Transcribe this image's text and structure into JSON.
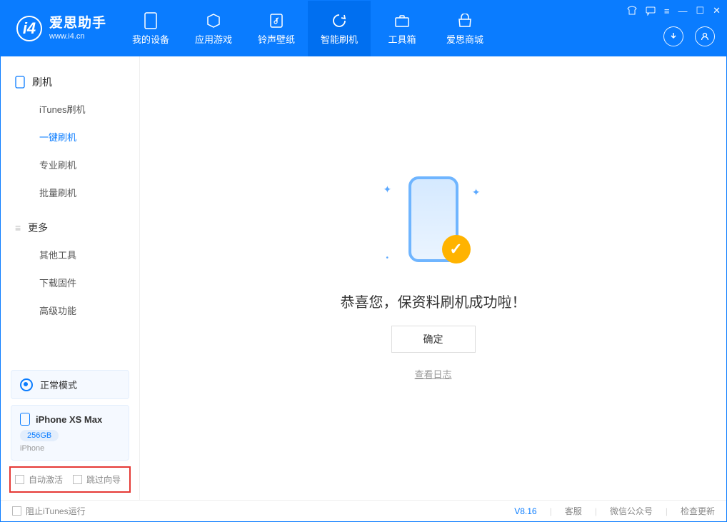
{
  "app": {
    "title": "爱思助手",
    "subtitle": "www.i4.cn"
  },
  "header_tabs": [
    {
      "label": "我的设备"
    },
    {
      "label": "应用游戏"
    },
    {
      "label": "铃声壁纸"
    },
    {
      "label": "智能刷机"
    },
    {
      "label": "工具箱"
    },
    {
      "label": "爱思商城"
    }
  ],
  "sidebar": {
    "section1_title": "刷机",
    "items1": [
      {
        "label": "iTunes刷机"
      },
      {
        "label": "一键刷机"
      },
      {
        "label": "专业刷机"
      },
      {
        "label": "批量刷机"
      }
    ],
    "section2_title": "更多",
    "items2": [
      {
        "label": "其他工具"
      },
      {
        "label": "下载固件"
      },
      {
        "label": "高级功能"
      }
    ],
    "mode": "正常模式",
    "device": {
      "name": "iPhone XS Max",
      "capacity": "256GB",
      "type": "iPhone"
    },
    "cb1": "自动激活",
    "cb2": "跳过向导"
  },
  "main": {
    "success_text": "恭喜您，保资料刷机成功啦！",
    "ok_button": "确定",
    "view_log": "查看日志"
  },
  "status": {
    "block_itunes": "阻止iTunes运行",
    "version": "V8.16",
    "support": "客服",
    "wechat": "微信公众号",
    "update": "检查更新"
  }
}
